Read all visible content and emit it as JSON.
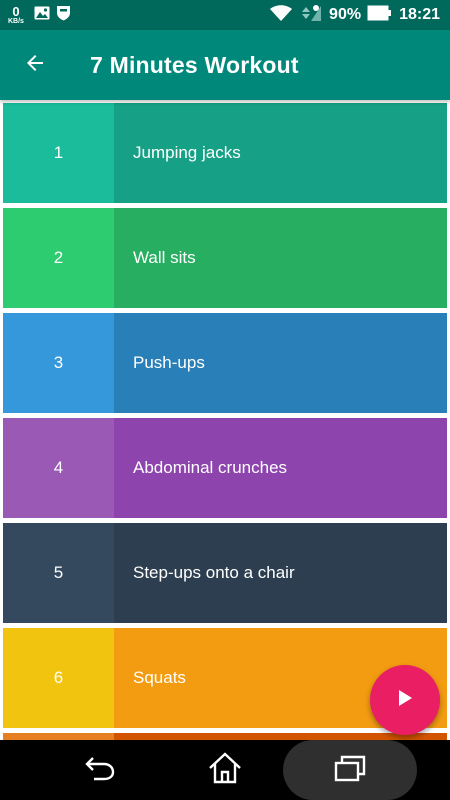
{
  "status_bar": {
    "net_speed_value": "0",
    "net_speed_unit": "KB/s",
    "battery": "90%",
    "time": "18:21"
  },
  "app_bar": {
    "title": "7 Minutes Workout",
    "back_icon": "arrow-back-icon"
  },
  "exercises": [
    {
      "number": "1",
      "name": "Jumping jacks",
      "num_color": "#1abc9c",
      "name_color": "#16a085"
    },
    {
      "number": "2",
      "name": "Wall sits",
      "num_color": "#2ecc71",
      "name_color": "#27ae60"
    },
    {
      "number": "3",
      "name": "Push-ups",
      "num_color": "#3498db",
      "name_color": "#2980b9"
    },
    {
      "number": "4",
      "name": "Abdominal crunches",
      "num_color": "#9b59b6",
      "name_color": "#8e44ad"
    },
    {
      "number": "5",
      "name": "Step-ups onto a chair",
      "num_color": "#34495e",
      "name_color": "#2c3e50"
    },
    {
      "number": "6",
      "name": "Squats",
      "num_color": "#f1c40f",
      "name_color": "#f39c12"
    },
    {
      "number": "",
      "name": "",
      "num_color": "#e67e22",
      "name_color": "#d35400"
    }
  ],
  "fab": {
    "icon": "play-icon",
    "color": "#e91e63"
  },
  "nav_bar": {
    "back_icon": "nav-back-icon",
    "home_icon": "home-icon",
    "recents_icon": "recents-icon"
  }
}
